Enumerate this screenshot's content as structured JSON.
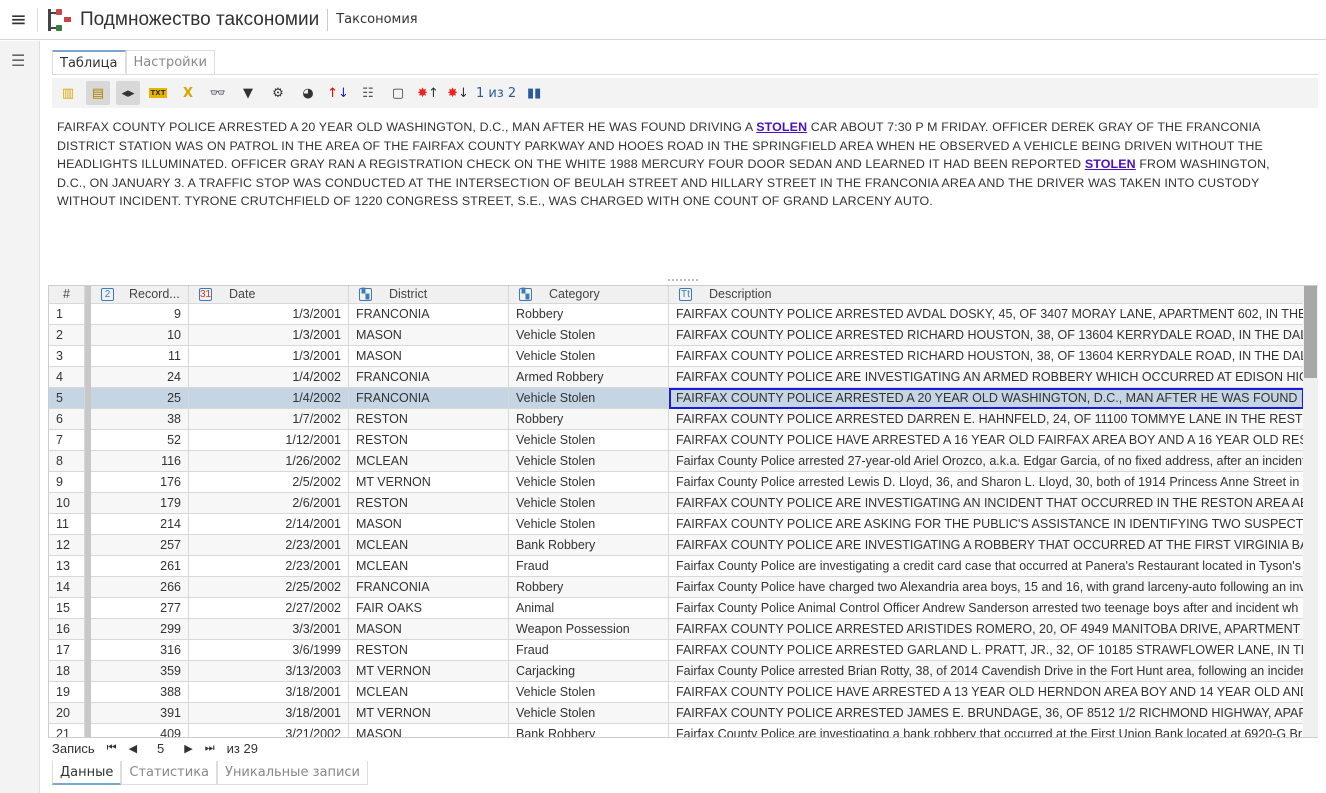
{
  "header": {
    "title": "Подмножество таксономии",
    "subtitle": "Таксономия"
  },
  "tabs": [
    {
      "label": "Таблица",
      "active": true
    },
    {
      "label": "Настройки",
      "active": false
    }
  ],
  "toolbar": {
    "icons": [
      "columns-icon",
      "grid-view-icon",
      "resize-columns-icon",
      "txt-icon",
      "export-icon",
      "binoculars-icon",
      "filter-icon",
      "settings-gear-icon",
      "palette-icon",
      "sort-icon",
      "list-icon",
      "note-icon",
      "highlight-up-icon",
      "highlight-down-icon",
      "chart-icon"
    ],
    "page_indicator": "1 из 2"
  },
  "text": {
    "p1": "FAIRFAX COUNTY POLICE ARRESTED A 20 YEAR OLD WASHINGTON, D.C., MAN AFTER HE WAS FOUND DRIVING A ",
    "link1": "STOLEN",
    "p2": " CAR ABOUT 7:30 P M FRIDAY. OFFICER DEREK GRAY OF THE FRANCONIA DISTRICT STATION WAS ON PATROL IN THE AREA OF THE FAIRFAX COUNTY PARKWAY AND HOOES ROAD IN THE SPRINGFIELD AREA WHEN HE OBSERVED A VEHICLE BEING DRIVEN WITHOUT THE HEADLIGHTS ILLUMINATED. OFFICER GRAY RAN A REGISTRATION CHECK ON THE WHITE 1988 MERCURY FOUR DOOR SEDAN AND LEARNED IT HAD BEEN REPORTED ",
    "link2": "STOLEN",
    "p3": " FROM WASHINGTON, D.C., ON JANUARY 3. A TRAFFIC STOP WAS CONDUCTED AT THE INTERSECTION OF BEULAH STREET AND HILLARY STREET IN THE FRANCONIA AREA AND THE DRIVER WAS TAKEN INTO CUSTODY WITHOUT INCIDENT. TYRONE CRUTCHFIELD OF 1220 CONGRESS STREET, S.E., WAS CHARGED WITH ONE COUNT OF GRAND LARCENY AUTO."
  },
  "grid": {
    "columns": [
      "#",
      "Record...",
      "Date",
      "District",
      "Category",
      "Description"
    ],
    "selected_row": 5,
    "rows": [
      [
        "1",
        "9",
        "1/3/2001",
        "FRANCONIA",
        "Robbery",
        "FAIRFAX COUNTY POLICE ARRESTED AVDAL DOSKY, 45, OF 3407 MORAY LANE, APARTMENT 602, IN THE BAILEYS"
      ],
      [
        "2",
        "10",
        "1/3/2001",
        "MASON",
        "Vehicle Stolen",
        "FAIRFAX COUNTY POLICE ARRESTED RICHARD HOUSTON, 38, OF 13604 KERRYDALE ROAD, IN THE DALE CITY ARE"
      ],
      [
        "3",
        "11",
        "1/3/2001",
        "MASON",
        "Vehicle Stolen",
        "FAIRFAX COUNTY POLICE ARRESTED RICHARD HOUSTON, 38, OF 13604 KERRYDALE ROAD, IN THE DALE CITY ARE"
      ],
      [
        "4",
        "24",
        "1/4/2002",
        "FRANCONIA",
        "Armed Robbery",
        "FAIRFAX COUNTY POLICE ARE INVESTIGATING AN ARMED ROBBERY WHICH OCCURRED AT EDISON HIGH SCHOO"
      ],
      [
        "5",
        "25",
        "1/4/2002",
        "FRANCONIA",
        "Vehicle Stolen",
        "FAIRFAX COUNTY POLICE ARRESTED A 20 YEAR OLD WASHINGTON, D.C., MAN AFTER HE WAS FOUND DRIVING A"
      ],
      [
        "6",
        "38",
        "1/7/2002",
        "RESTON",
        "Robbery",
        "FAIRFAX COUNTY POLICE ARRESTED DARREN E. HAHNFELD, 24, OF 11100 TOMMYE LANE IN THE RESTON AREA F"
      ],
      [
        "7",
        "52",
        "1/12/2001",
        "RESTON",
        "Vehicle Stolen",
        "FAIRFAX COUNTY POLICE HAVE ARRESTED A 16 YEAR OLD FAIRFAX AREA BOY AND A 16 YEAR OLD RESTON AREA"
      ],
      [
        "8",
        "116",
        "1/26/2002",
        "MCLEAN",
        "Vehicle Stolen",
        "Fairfax County Police arrested 27-year-old Ariel Orozco, a.k.a. Edgar Garcia, of no fixed address, after an incident"
      ],
      [
        "9",
        "176",
        "2/5/2002",
        "MT VERNON",
        "Vehicle Stolen",
        "Fairfax County Police arrested Lewis D. Lloyd, 36, and Sharon L. Lloyd, 30, both of 1914 Princess Anne Street in Fr"
      ],
      [
        "10",
        "179",
        "2/6/2001",
        "RESTON",
        "Vehicle Stolen",
        "FAIRFAX COUNTY POLICE ARE INVESTIGATING AN INCIDENT THAT OCCURRED IN THE RESTON AREA ABOUT 12:30"
      ],
      [
        "11",
        "214",
        "2/14/2001",
        "MASON",
        "Vehicle Stolen",
        "FAIRFAX COUNTY POLICE ARE ASKING FOR THE PUBLIC'S ASSISTANCE IN IDENTIFYING TWO SUSPECTS SEEN GETT"
      ],
      [
        "12",
        "257",
        "2/23/2001",
        "MCLEAN",
        "Bank Robbery",
        "FAIRFAX COUNTY POLICE ARE INVESTIGATING A ROBBERY THAT OCCURRED AT THE FIRST VIRGINIA BANK, LOCAT"
      ],
      [
        "13",
        "261",
        "2/23/2001",
        "MCLEAN",
        "Fraud",
        "Fairfax County Police are investigating a credit card case that occurred at Panera's Restaurant located in Tyson's"
      ],
      [
        "14",
        "266",
        "2/25/2002",
        "FRANCONIA",
        "Robbery",
        "Fairfax County Police have charged two Alexandria area boys, 15 and 16, with grand larceny-auto following an inv"
      ],
      [
        "15",
        "277",
        "2/27/2002",
        "FAIR OAKS",
        "Animal",
        "Fairfax County Police Animal Control Officer Andrew Sanderson arrested two teenage boys after and incident wh"
      ],
      [
        "16",
        "299",
        "3/3/2001",
        "MASON",
        "Weapon Possession",
        "FAIRFAX COUNTY POLICE ARRESTED ARISTIDES ROMERO, 20, OF 4949 MANITOBA DRIVE, APARTMENT 501, IN TH"
      ],
      [
        "17",
        "316",
        "3/6/1999",
        "RESTON",
        "Fraud",
        "FAIRFAX COUNTY POLICE ARRESTED GARLAND L. PRATT, JR., 32, OF 10185 STRAWFLOWER LANE, IN THE MANASS"
      ],
      [
        "18",
        "359",
        "3/13/2003",
        "MT VERNON",
        "Carjacking",
        "Fairfax County Police arrested Brian Rotty, 38, of 2014 Cavendish Drive in the Fort Hunt area, following an incider"
      ],
      [
        "19",
        "388",
        "3/18/2001",
        "MCLEAN",
        "Vehicle Stolen",
        "FAIRFAX COUNTY POLICE HAVE ARRESTED A 13 YEAR OLD HERNDON AREA BOY AND 14 YEAR OLD AND 15 YEAR"
      ],
      [
        "20",
        "391",
        "3/18/2001",
        "MT VERNON",
        "Vehicle Stolen",
        "FAIRFAX COUNTY POLICE ARRESTED JAMES E. BRUNDAGE, 36, OF 8512 1/2 RICHMOND HIGHWAY, APARTMENT 3"
      ],
      [
        "21",
        "409",
        "3/21/2002",
        "MASON",
        "Bank Robbery",
        "Fairfax County Police are investigating a bank robbery that occurred at the First Union Bank located at 6920-G Br"
      ]
    ]
  },
  "navigator": {
    "label": "Запись",
    "current": "5",
    "total": "из 29"
  },
  "bottom_tabs": [
    {
      "label": "Данные",
      "active": true
    },
    {
      "label": "Статистика",
      "active": false
    },
    {
      "label": "Уникальные записи",
      "active": false
    }
  ]
}
